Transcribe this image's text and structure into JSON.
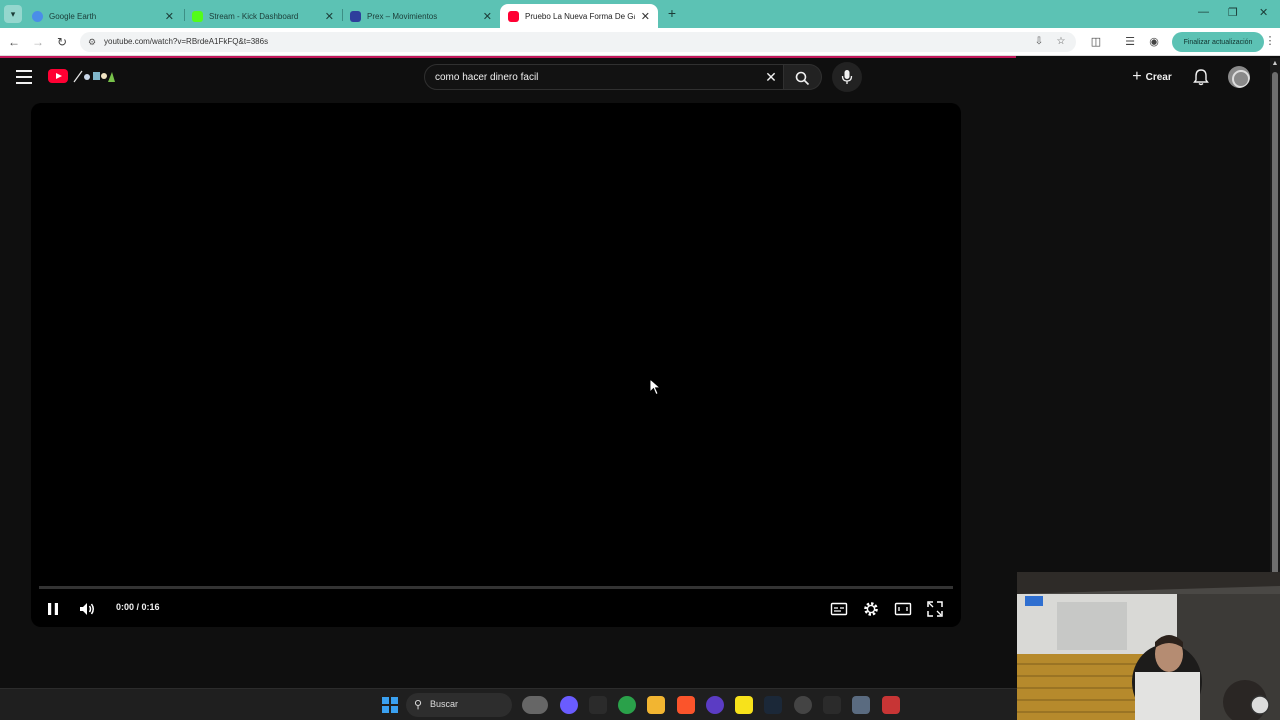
{
  "browser": {
    "tabs": [
      {
        "title": "Google Earth",
        "icon": "google-earth-icon",
        "color": "#4a8ee8",
        "active": false
      },
      {
        "title": "Stream - Kick Dashboard",
        "icon": "kick-icon",
        "color": "#53fc18",
        "active": false
      },
      {
        "title": "Prex – Movimientos",
        "icon": "prex-icon",
        "color": "#2e3e9c",
        "active": false
      },
      {
        "title": "Pruebo La Nueva Forma De Ga",
        "icon": "youtube-icon",
        "color": "#ff0033",
        "active": true
      }
    ],
    "url": "youtube.com/watch?v=RBrdeA1FkFQ&t=386s",
    "update_button": "Finalizar actualización",
    "accent": "#5cc2b4"
  },
  "youtube": {
    "search_query": "como hacer dinero facil",
    "create_label": "Crear",
    "brand_color": "#ff0033"
  },
  "player": {
    "current_time": "0:00",
    "duration": "0:16",
    "time_display": "0:00 / 0:16",
    "progress_fraction": 0.0,
    "state": "playing"
  },
  "taskbar": {
    "search_label": "Buscar"
  }
}
